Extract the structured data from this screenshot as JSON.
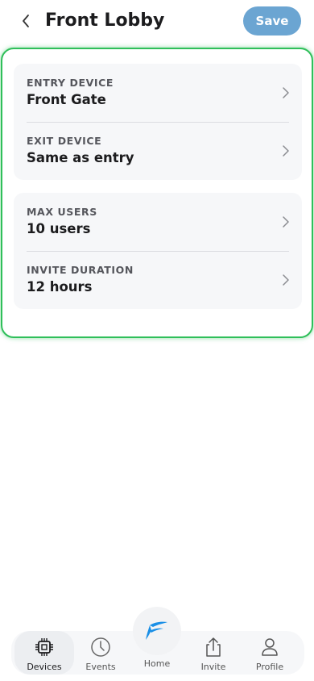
{
  "header": {
    "title": "Front Lobby",
    "save_label": "Save"
  },
  "settings": {
    "card1": [
      {
        "label": "ENTRY DEVICE",
        "value": "Front Gate"
      },
      {
        "label": "EXIT DEVICE",
        "value": "Same as entry"
      }
    ],
    "card2": [
      {
        "label": "MAX USERS",
        "value": "10 users"
      },
      {
        "label": "INVITE DURATION",
        "value": "12 hours"
      }
    ]
  },
  "tabbar": {
    "items": [
      {
        "label": "Devices",
        "icon": "chip-icon"
      },
      {
        "label": "Events",
        "icon": "clock-icon"
      },
      {
        "label": "Home",
        "icon": "brand-logo-icon"
      },
      {
        "label": "Invite",
        "icon": "share-icon"
      },
      {
        "label": "Profile",
        "icon": "person-icon"
      }
    ],
    "active": "Devices"
  },
  "colors": {
    "accent": "#6ba5d2",
    "panel_border": "#2fbf5a",
    "brand_blue": "#1a8fe6"
  }
}
